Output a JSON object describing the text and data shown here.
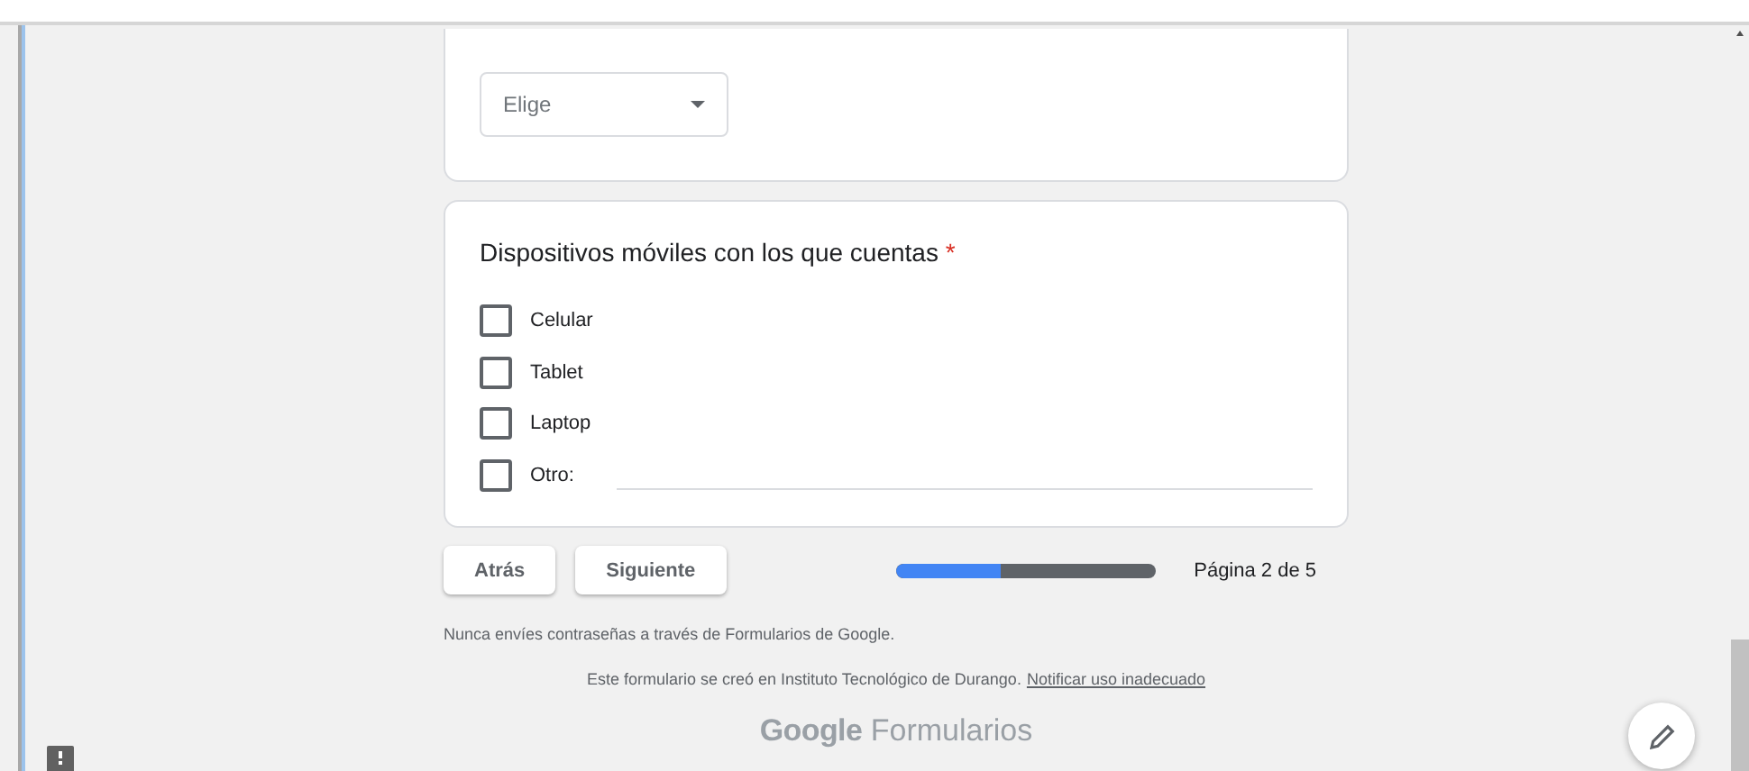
{
  "dropdown": {
    "label": "Elige"
  },
  "question": {
    "title": "Dispositivos móviles con los que cuentas",
    "required_mark": "*",
    "options": [
      {
        "label": "Celular",
        "checked": false,
        "kind": "choice"
      },
      {
        "label": "Tablet",
        "checked": false,
        "kind": "choice"
      },
      {
        "label": "Laptop",
        "checked": false,
        "kind": "choice"
      },
      {
        "label": "Otro:",
        "checked": false,
        "kind": "other"
      }
    ]
  },
  "buttons": [
    "Atrás",
    "Siguiente"
  ],
  "progress": {
    "level": 0.4,
    "label": "Página 2 de 5"
  },
  "footer": {
    "notice": "Nunca envíes contraseñas a través de Formularios de Google.",
    "creator": "Este formulario se creó en Instituto Tecnológico de Durango.",
    "report_link": "Notificar uso inadecuado"
  },
  "logo": {
    "brand": "Google",
    "product": "Formularios"
  }
}
